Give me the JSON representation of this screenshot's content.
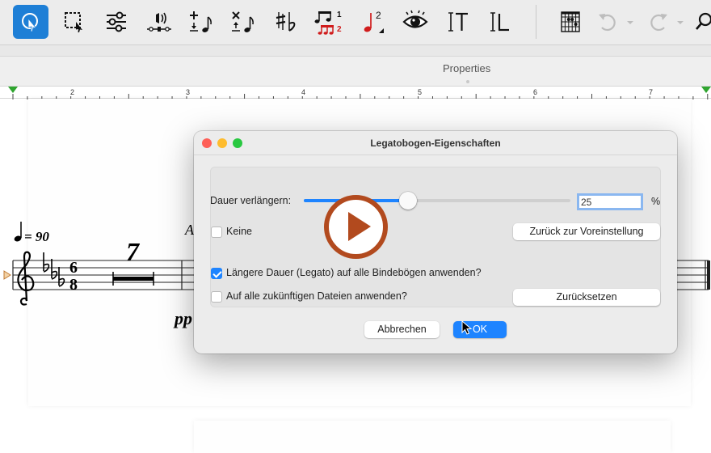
{
  "toolbar": {
    "tools": [
      {
        "name": "select-tool",
        "active": true
      },
      {
        "name": "marquee-select-tool"
      },
      {
        "name": "mixer-tool"
      },
      {
        "name": "playback-tool"
      },
      {
        "name": "add-note-tool"
      },
      {
        "name": "delete-note-tool"
      },
      {
        "name": "accidental-tool"
      },
      {
        "name": "tuplet-tool"
      },
      {
        "name": "voice-tool"
      },
      {
        "name": "view-tool"
      },
      {
        "name": "text-tool"
      },
      {
        "name": "lyrics-tool"
      },
      {
        "name": "chord-diagram-tool"
      },
      {
        "name": "undo"
      },
      {
        "name": "redo"
      },
      {
        "name": "zoom-tool"
      }
    ],
    "tuplet_superscript": "1",
    "tuplet_subscript": "2",
    "voice_superscript": "2"
  },
  "properties": {
    "title": "Properties"
  },
  "ruler": {
    "numbers": [
      "2",
      "3",
      "4",
      "5",
      "6",
      "7"
    ]
  },
  "score": {
    "tempo_value": "= 90",
    "tuplet_number": "7",
    "dynamic": "pp",
    "rehearsal_mark": "A",
    "clef": "treble",
    "key_signature": "3 flats",
    "time_signature_top": "6",
    "time_signature_bottom": "8"
  },
  "dialog": {
    "title": "Legatobogen-Eigenschaften",
    "duration_label": "Dauer verlängern:",
    "duration_value": "25",
    "duration_unit": "%",
    "slider_fraction": 0.39,
    "none_label": "Keine",
    "none_checked": false,
    "reset_default_button": "Zurück zur Voreinstellung",
    "apply_all_label": "Längere Dauer (Legato) auf alle Bindebögen anwenden?",
    "apply_all_checked": true,
    "future_files_label": "Auf alle zukünftigen Dateien anwenden?",
    "future_files_checked": false,
    "reset_button": "Zurücksetzen",
    "cancel_button": "Abbrechen",
    "ok_button": "OK"
  },
  "colors": {
    "accent": "#1e84ff",
    "toolbar_active": "#1e7fd6",
    "play_overlay": "#b24a1e",
    "close_light": "#fe5f57",
    "minimize_light": "#febc2e",
    "zoom_light": "#28c840"
  }
}
